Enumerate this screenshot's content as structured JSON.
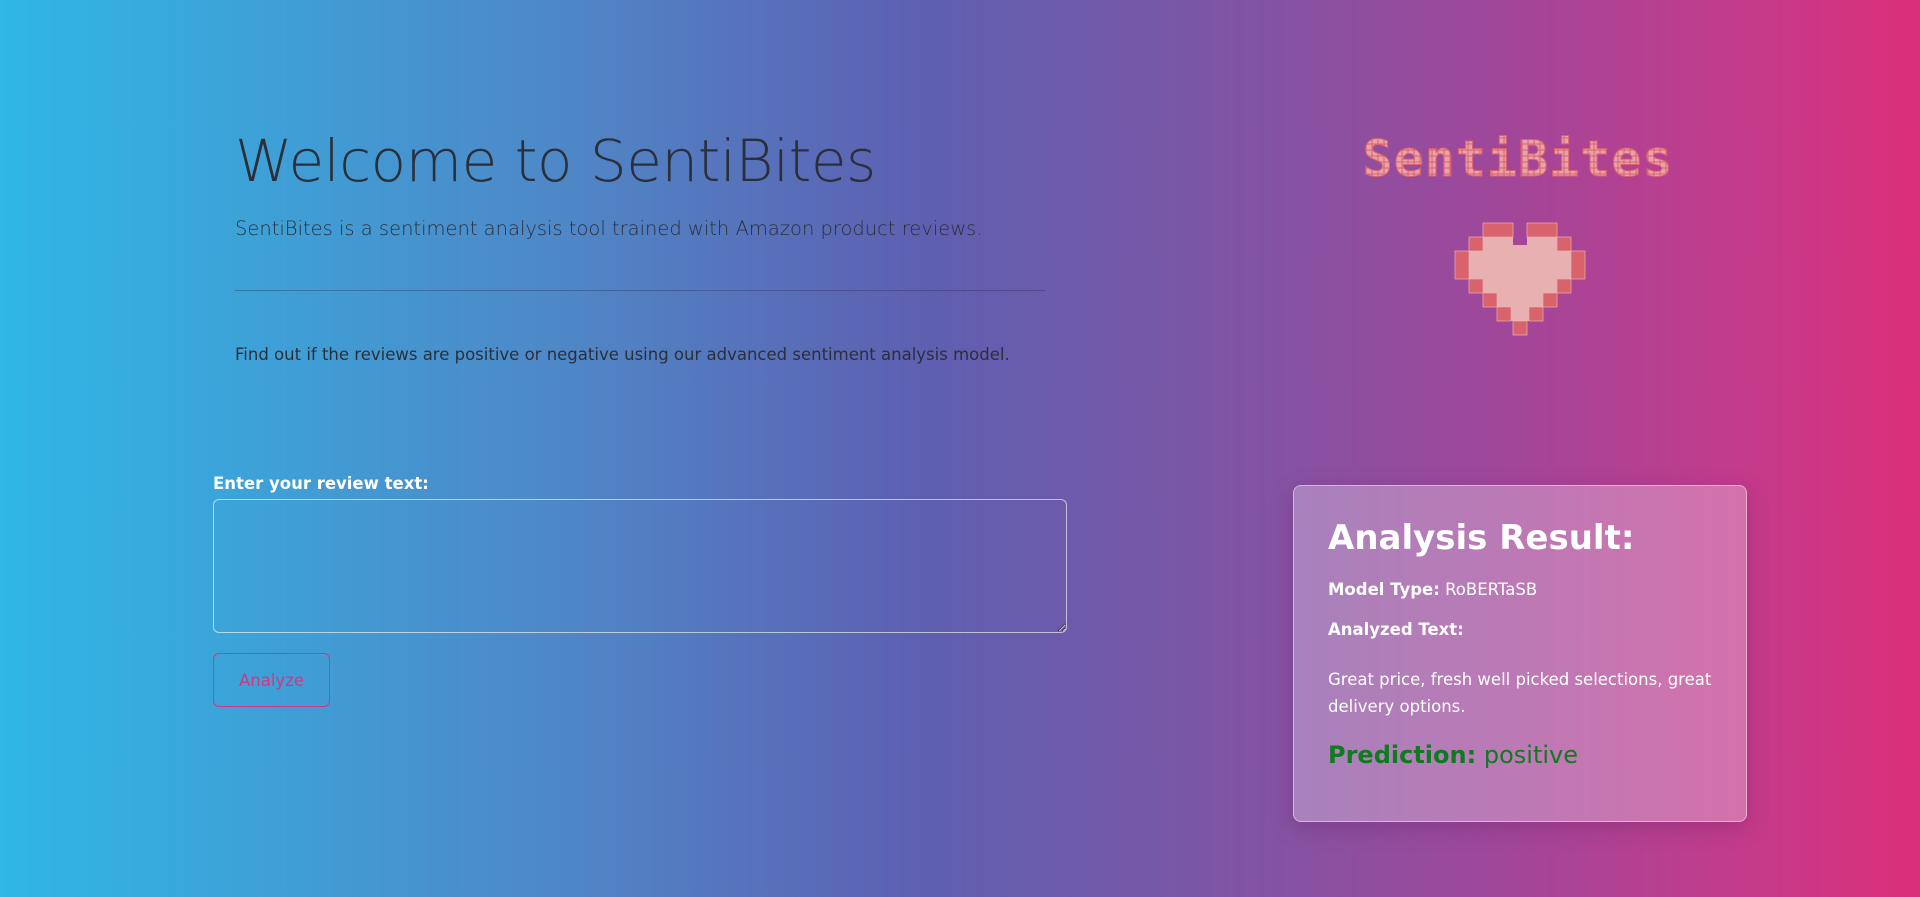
{
  "hero": {
    "title": "Welcome to SentiBites",
    "lead": "SentiBites is a sentiment analysis tool trained with Amazon product reviews.",
    "sub": "Find out if the reviews are positive or negative using our advanced sentiment analysis model."
  },
  "logo": {
    "wordmark": "SentiBites",
    "icon": "pixel-heart-icon",
    "colors": {
      "fill": "#e9a3a8",
      "accent": "#d9636d"
    }
  },
  "form": {
    "label": "Enter your review text:",
    "input_value": "",
    "input_placeholder": "",
    "submit_label": "Analyze"
  },
  "result": {
    "title": "Analysis Result:",
    "model_type_label": "Model Type:",
    "model_type_value": "RoBERTaSB",
    "analyzed_text_label": "Analyzed Text:",
    "analyzed_text_value": "Great price, fresh well picked selections, great delivery options.",
    "prediction_label": "Prediction:",
    "prediction_value": "positive"
  },
  "colors": {
    "accent_pink": "#d83580",
    "prediction_green": "#0f7a1f",
    "gradient_start": "#2fb7e6",
    "gradient_end": "#dc2f7a"
  }
}
